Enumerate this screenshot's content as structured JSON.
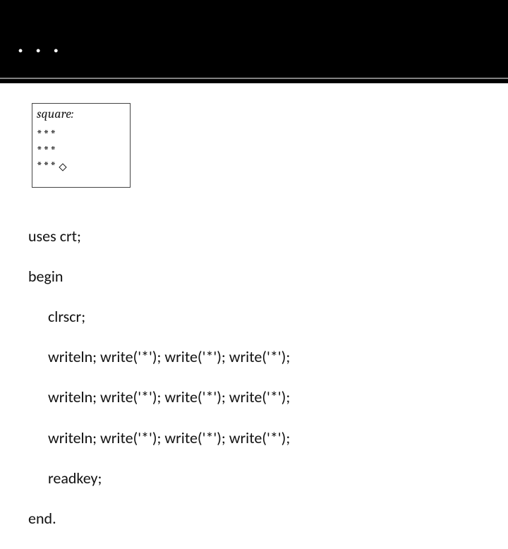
{
  "header": {
    "title": ". . ."
  },
  "output": {
    "label": "square:",
    "row1": "***",
    "row2": "***",
    "row3": "***"
  },
  "code": {
    "l1": "uses crt;",
    "l2": "begin",
    "l3": "clrscr;",
    "l4": "writeln; write('*'); write('*'); write('*');",
    "l5": "writeln; write('*'); write('*'); write('*');",
    "l6": "writeln; write('*'); write('*'); write('*');",
    "l7": "readkey;",
    "l8": "end."
  }
}
